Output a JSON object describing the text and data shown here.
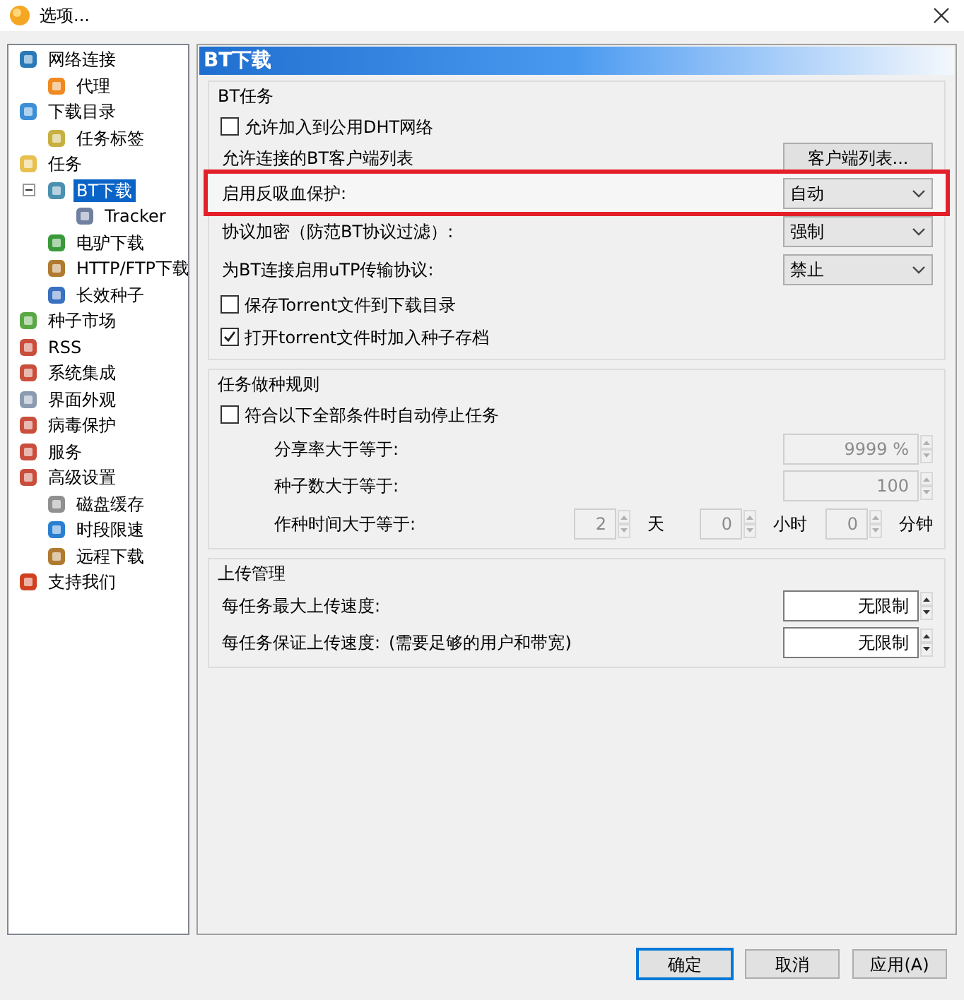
{
  "window": {
    "title": "选项..."
  },
  "tree": [
    {
      "label": "网络连接",
      "selected": false,
      "children": [
        {
          "label": "代理",
          "selected": false
        }
      ]
    },
    {
      "label": "下载目录",
      "selected": false,
      "children": [
        {
          "label": "任务标签",
          "selected": false
        }
      ]
    },
    {
      "label": "任务",
      "selected": false,
      "children": [
        {
          "label": "BT下载",
          "selected": true,
          "expanded": true,
          "children": [
            {
              "label": "Tracker",
              "selected": false
            }
          ]
        },
        {
          "label": "电驴下载",
          "selected": false
        },
        {
          "label": "HTTP/FTP下载",
          "selected": false
        },
        {
          "label": "长效种子",
          "selected": false
        }
      ]
    },
    {
      "label": "种子市场",
      "selected": false
    },
    {
      "label": "RSS",
      "selected": false
    },
    {
      "label": "系统集成",
      "selected": false
    },
    {
      "label": "界面外观",
      "selected": false
    },
    {
      "label": "病毒保护",
      "selected": false
    },
    {
      "label": "服务",
      "selected": false
    },
    {
      "label": "高级设置",
      "selected": false,
      "children": [
        {
          "label": "磁盘缓存",
          "selected": false
        },
        {
          "label": "时段限速",
          "selected": false
        },
        {
          "label": "远程下载",
          "selected": false
        }
      ]
    },
    {
      "label": "支持我们",
      "selected": false
    }
  ],
  "page": {
    "title": "BT下载",
    "groups": [
      {
        "title": "BT任务",
        "rows": [
          {
            "kind": "checkbox",
            "label": "允许加入到公用DHT网络",
            "checked": false,
            "highlighted": false
          },
          {
            "kind": "button",
            "label": "允许连接的BT客户端列表",
            "button": "客户端列表...",
            "highlighted": false
          },
          {
            "kind": "select",
            "label": "启用反吸血保护:",
            "value": "自动",
            "highlighted": true
          },
          {
            "kind": "select",
            "label": "协议加密（防范BT协议过滤）:",
            "value": "强制",
            "highlighted": false
          },
          {
            "kind": "select",
            "label": "为BT连接启用uTP传输协议:",
            "value": "禁止",
            "highlighted": false
          },
          {
            "kind": "checkbox",
            "label": "保存Torrent文件到下载目录",
            "checked": false,
            "highlighted": false
          },
          {
            "kind": "checkbox",
            "label": "打开torrent文件时加入种子存档",
            "checked": true,
            "highlighted": false
          }
        ]
      },
      {
        "title": "任务做种规则",
        "rows": [
          {
            "kind": "checkbox",
            "label": "符合以下全部条件时自动停止任务",
            "checked": false,
            "highlighted": false,
            "children": [
              {
                "kind": "spin",
                "label": "分享率大于等于:",
                "value": "9999 %",
                "disabled": true,
                "highlighted": false
              },
              {
                "kind": "spin",
                "label": "种子数大于等于:",
                "value": "100",
                "disabled": true,
                "highlighted": false
              },
              {
                "kind": "time",
                "label": "作种时间大于等于:",
                "disabled": true,
                "highlighted": false,
                "parts": [
                  {
                    "value": "2",
                    "unit": "天"
                  },
                  {
                    "value": "0",
                    "unit": "小时"
                  },
                  {
                    "value": "0",
                    "unit": "分钟"
                  }
                ]
              }
            ]
          }
        ]
      },
      {
        "title": "上传管理",
        "rows": [
          {
            "kind": "spin",
            "label": "每任务最大上传速度:",
            "value": "无限制",
            "disabled": false,
            "highlighted": false
          },
          {
            "kind": "spin",
            "label": "每任务保证上传速度:",
            "note": "(需要足够的用户和带宽)",
            "value": "无限制",
            "disabled": false,
            "highlighted": false
          }
        ]
      }
    ]
  },
  "buttons": [
    {
      "label": "确定",
      "default": true
    },
    {
      "label": "取消",
      "default": false
    },
    {
      "label": "应用(A)",
      "default": false
    }
  ]
}
